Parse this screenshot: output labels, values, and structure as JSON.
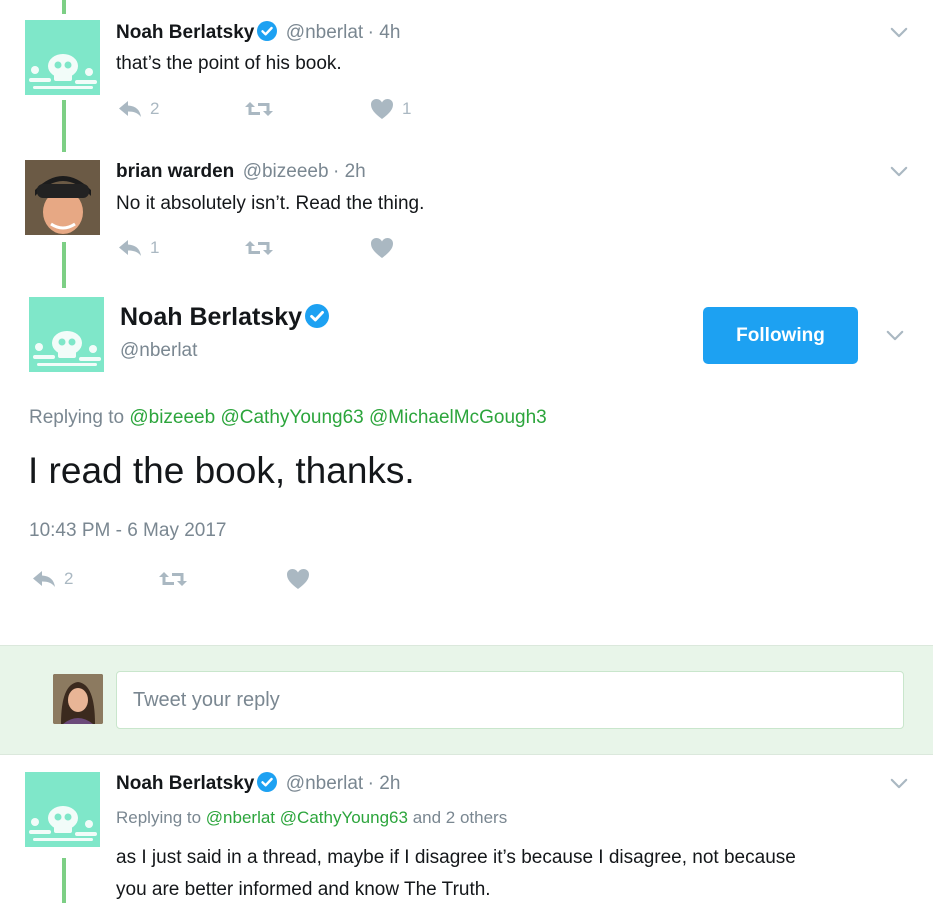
{
  "tweets": [
    {
      "name": "Noah Berlatsky",
      "handle": "@nberlat",
      "time": "· 4h",
      "text": "that’s the point of his book.",
      "reply_count": "2",
      "retweet_count": "",
      "like_count": "1"
    },
    {
      "name": "brian warden",
      "handle": "@bizeeeb",
      "time": "· 2h",
      "text": "No it absolutely isn’t. Read the thing.",
      "reply_count": "1",
      "retweet_count": "",
      "like_count": ""
    }
  ],
  "main_tweet": {
    "name": "Noah Berlatsky",
    "handle": "@nberlat",
    "follow_label": "Following",
    "replying_label": "Replying to",
    "replying_mentions": [
      "@bizeeeb",
      "@CathyYoung63",
      "@MichaelMcGough3"
    ],
    "text": "I read the book, thanks.",
    "timestamp": "10:43 PM - 6 May 2017",
    "reply_count": "2"
  },
  "reply_box": {
    "placeholder": "Tweet your reply"
  },
  "bottom_tweet": {
    "name": "Noah Berlatsky",
    "handle": "@nberlat",
    "time": "· 2h",
    "replying_label": "Replying to",
    "replying_mentions": [
      "@nberlat",
      "@CathyYoung63"
    ],
    "replying_suffix": "and 2 others",
    "text_line1": "as I just said in a thread, maybe if I disagree it’s because I disagree, not because",
    "text_line2": "you are better informed and know The Truth."
  },
  "colors": {
    "accent_blue": "#1da1f2",
    "mention_green": "#2ca53c",
    "thread_line": "#7dcf85",
    "avatar_bg": "#7fe7c9",
    "muted": "#aab8c2"
  },
  "icons": [
    "reply-icon",
    "retweet-icon",
    "like-icon",
    "verified-icon",
    "chevron-down-icon"
  ]
}
